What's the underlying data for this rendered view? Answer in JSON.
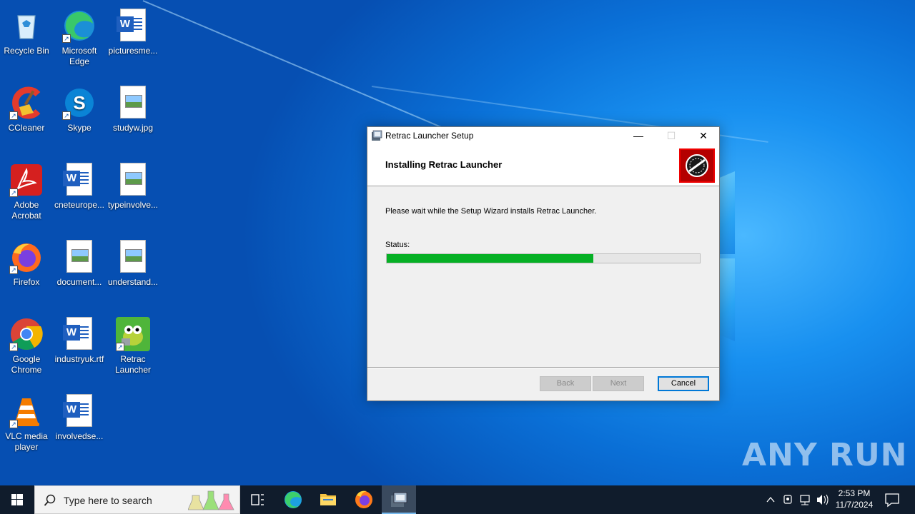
{
  "desktop": {
    "icons": [
      {
        "label": "Recycle Bin",
        "icon": "recycle-bin-icon"
      },
      {
        "label": "Microsoft Edge",
        "icon": "edge-icon"
      },
      {
        "label": "picturesme...",
        "icon": "word-document-icon"
      },
      {
        "label": "CCleaner",
        "icon": "ccleaner-icon"
      },
      {
        "label": "Skype",
        "icon": "skype-icon"
      },
      {
        "label": "studyw.jpg",
        "icon": "image-file-icon"
      },
      {
        "label": "Adobe Acrobat",
        "icon": "acrobat-icon"
      },
      {
        "label": "cneteurope...",
        "icon": "word-document-icon"
      },
      {
        "label": "typeinvolve...",
        "icon": "image-file-icon"
      },
      {
        "label": "Firefox",
        "icon": "firefox-icon"
      },
      {
        "label": "document...",
        "icon": "image-file-icon"
      },
      {
        "label": "understand...",
        "icon": "image-file-icon"
      },
      {
        "label": "Google Chrome",
        "icon": "chrome-icon"
      },
      {
        "label": "industryuk.rtf",
        "icon": "word-document-icon"
      },
      {
        "label": "Retrac Launcher",
        "icon": "retrac-launcher-icon"
      },
      {
        "label": "VLC media player",
        "icon": "vlc-icon"
      },
      {
        "label": "involvedse...",
        "icon": "word-document-icon"
      }
    ]
  },
  "dialog": {
    "title": "Retrac Launcher Setup",
    "header_title": "Installing Retrac Launcher",
    "message": "Please wait while the Setup Wizard installs Retrac Launcher.",
    "status_label": "Status:",
    "progress_fraction": 0.66,
    "buttons": {
      "back": "Back",
      "next": "Next",
      "cancel": "Cancel"
    },
    "window_controls": {
      "minimize": "—",
      "maximize": "☐",
      "close": "✕"
    }
  },
  "watermark": "ANY RUN",
  "taskbar": {
    "search_placeholder": "Type here to search",
    "pinned": [
      "task-view-icon",
      "edge-icon",
      "file-explorer-icon",
      "firefox-icon",
      "setup-installer-icon"
    ],
    "clock_time": "2:53 PM",
    "clock_date": "11/7/2024"
  },
  "colors": {
    "progress_green": "#06b025",
    "accent_blue": "#0078d7",
    "taskbar_bg": "#101c2c"
  }
}
